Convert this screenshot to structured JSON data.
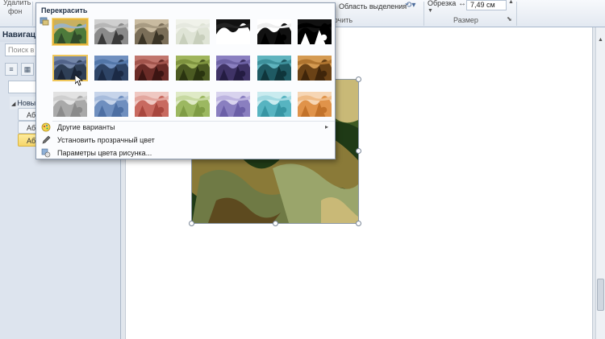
{
  "ribbon": {
    "remove_background": "Удалить\nфон",
    "remove_background_line1": "Удалить",
    "remove_background_line2": "фон",
    "selection_pane": "Область выделения",
    "arrange_group": "ючить",
    "crop": "Обрезка",
    "width_value": "7,49 см",
    "size_group": "Размер"
  },
  "nav": {
    "title": "Навигаци",
    "search_placeholder": "Поиск в д",
    "tree_root": "Новы",
    "items": [
      "Аб",
      "Аб",
      "Аб"
    ]
  },
  "recolor_menu": {
    "title": "Перекрасить",
    "rows": [
      [
        {
          "name": "original",
          "colors": [
            "#4d7a3b",
            "#c8b060",
            "#2f4a2a",
            "#9cb3c4"
          ]
        },
        {
          "name": "grayscale",
          "colors": [
            "#8a8a8a",
            "#d0d0d0",
            "#3a3a3a",
            "#b6b6b6"
          ]
        },
        {
          "name": "sepia",
          "colors": [
            "#7a6e58",
            "#c9bba0",
            "#3a3426",
            "#a89b82"
          ]
        },
        {
          "name": "washout",
          "colors": [
            "#dfe4d6",
            "#f0f2ea",
            "#c8cfbc",
            "#e6e9e0"
          ]
        },
        {
          "name": "black-white-25",
          "colors": [
            "#ffffff",
            "#111111",
            "#ffffff",
            "#222222"
          ]
        },
        {
          "name": "black-white-50",
          "colors": [
            "#111111",
            "#ffffff",
            "#000000",
            "#eeeeee"
          ]
        },
        {
          "name": "black-white-75",
          "colors": [
            "#000000",
            "#111111",
            "#ffffff",
            "#000000"
          ]
        }
      ],
      [
        {
          "name": "dark-variation-1",
          "colors": [
            "#2f3f56",
            "#7386a8",
            "#1a2436",
            "#52648a"
          ]
        },
        {
          "name": "dark-variation-2",
          "colors": [
            "#2e4466",
            "#6f8fbf",
            "#1b2a45",
            "#5276a8"
          ]
        },
        {
          "name": "dark-variation-3",
          "colors": [
            "#6a2b27",
            "#c0756d",
            "#3c1513",
            "#a2544c"
          ]
        },
        {
          "name": "dark-variation-4",
          "colors": [
            "#4b5a22",
            "#9fb45c",
            "#2a3410",
            "#7e933f"
          ]
        },
        {
          "name": "dark-variation-5",
          "colors": [
            "#3f3366",
            "#8a7fc0",
            "#241c42",
            "#6d62a4"
          ]
        },
        {
          "name": "dark-variation-6",
          "colors": [
            "#1f5a63",
            "#5fb3be",
            "#0f353b",
            "#3e919c"
          ]
        },
        {
          "name": "dark-variation-7",
          "colors": [
            "#6a4216",
            "#d49a52",
            "#3f250a",
            "#b07530"
          ]
        }
      ],
      [
        {
          "name": "light-variation-1",
          "colors": [
            "#a9a9a9",
            "#e2e2e2",
            "#8b8b8b",
            "#cfcfcf"
          ]
        },
        {
          "name": "light-variation-2",
          "colors": [
            "#6f8fbf",
            "#c6d4ea",
            "#4d6fa3",
            "#a7bcdc"
          ]
        },
        {
          "name": "light-variation-3",
          "colors": [
            "#c86a60",
            "#efc8c2",
            "#a8473e",
            "#e3a79f"
          ]
        },
        {
          "name": "light-variation-4",
          "colors": [
            "#9cb861",
            "#dfeac6",
            "#7f9c45",
            "#c7d9a1"
          ]
        },
        {
          "name": "light-variation-5",
          "colors": [
            "#8a7fc0",
            "#d8d3ee",
            "#6b5fa7",
            "#bdb4e0"
          ]
        },
        {
          "name": "light-variation-6",
          "colors": [
            "#57b4c1",
            "#c9ebef",
            "#3795a3",
            "#a3dae2"
          ]
        },
        {
          "name": "light-variation-7",
          "colors": [
            "#e0934a",
            "#f6d6b5",
            "#c2722a",
            "#efbb86"
          ]
        }
      ]
    ],
    "items": {
      "more_variations": "Другие варианты",
      "set_transparent": "Установить прозрачный цвет",
      "color_options": "Параметры цвета рисунка..."
    }
  },
  "picture": {
    "colors": [
      "#3e5a22",
      "#8a7a38",
      "#c9b977",
      "#6f7a45",
      "#b7c7d4",
      "#1f3a16",
      "#9aa56b",
      "#5d4a1f",
      "#d9d6b8",
      "#2c4a2d"
    ]
  }
}
